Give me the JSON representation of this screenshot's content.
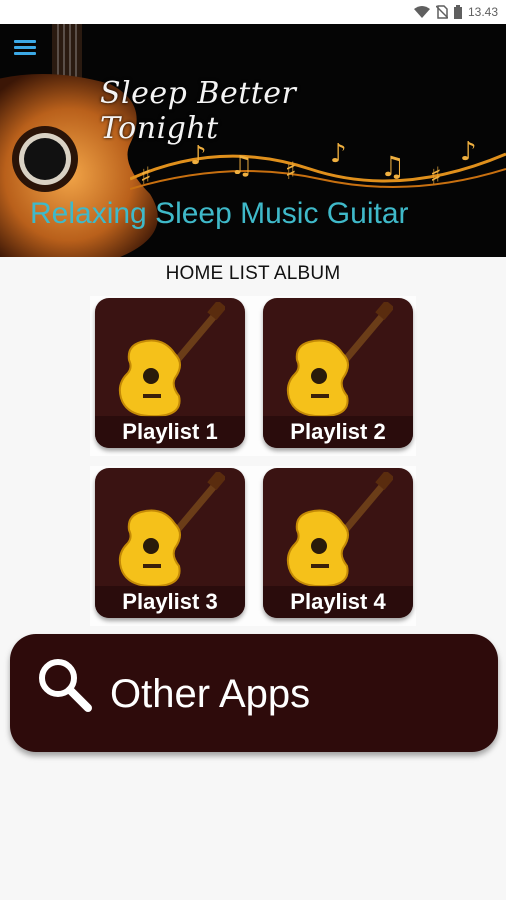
{
  "status_bar": {
    "time": "13.43"
  },
  "banner": {
    "title": "Sleep Better Tonight",
    "subtitle": "Relaxing Sleep Music Guitar"
  },
  "section_title": "HOME LIST ALBUM",
  "playlists": [
    {
      "label": "Playlist 1"
    },
    {
      "label": "Playlist 2"
    },
    {
      "label": "Playlist 3"
    },
    {
      "label": "Playlist 4"
    }
  ],
  "other_apps": {
    "label": "Other Apps"
  },
  "colors": {
    "tile_bg": "#3a1312",
    "subtitle": "#3fb9c9",
    "menu_icon": "#3ca9e6",
    "button_bg": "#2e0b0b"
  }
}
